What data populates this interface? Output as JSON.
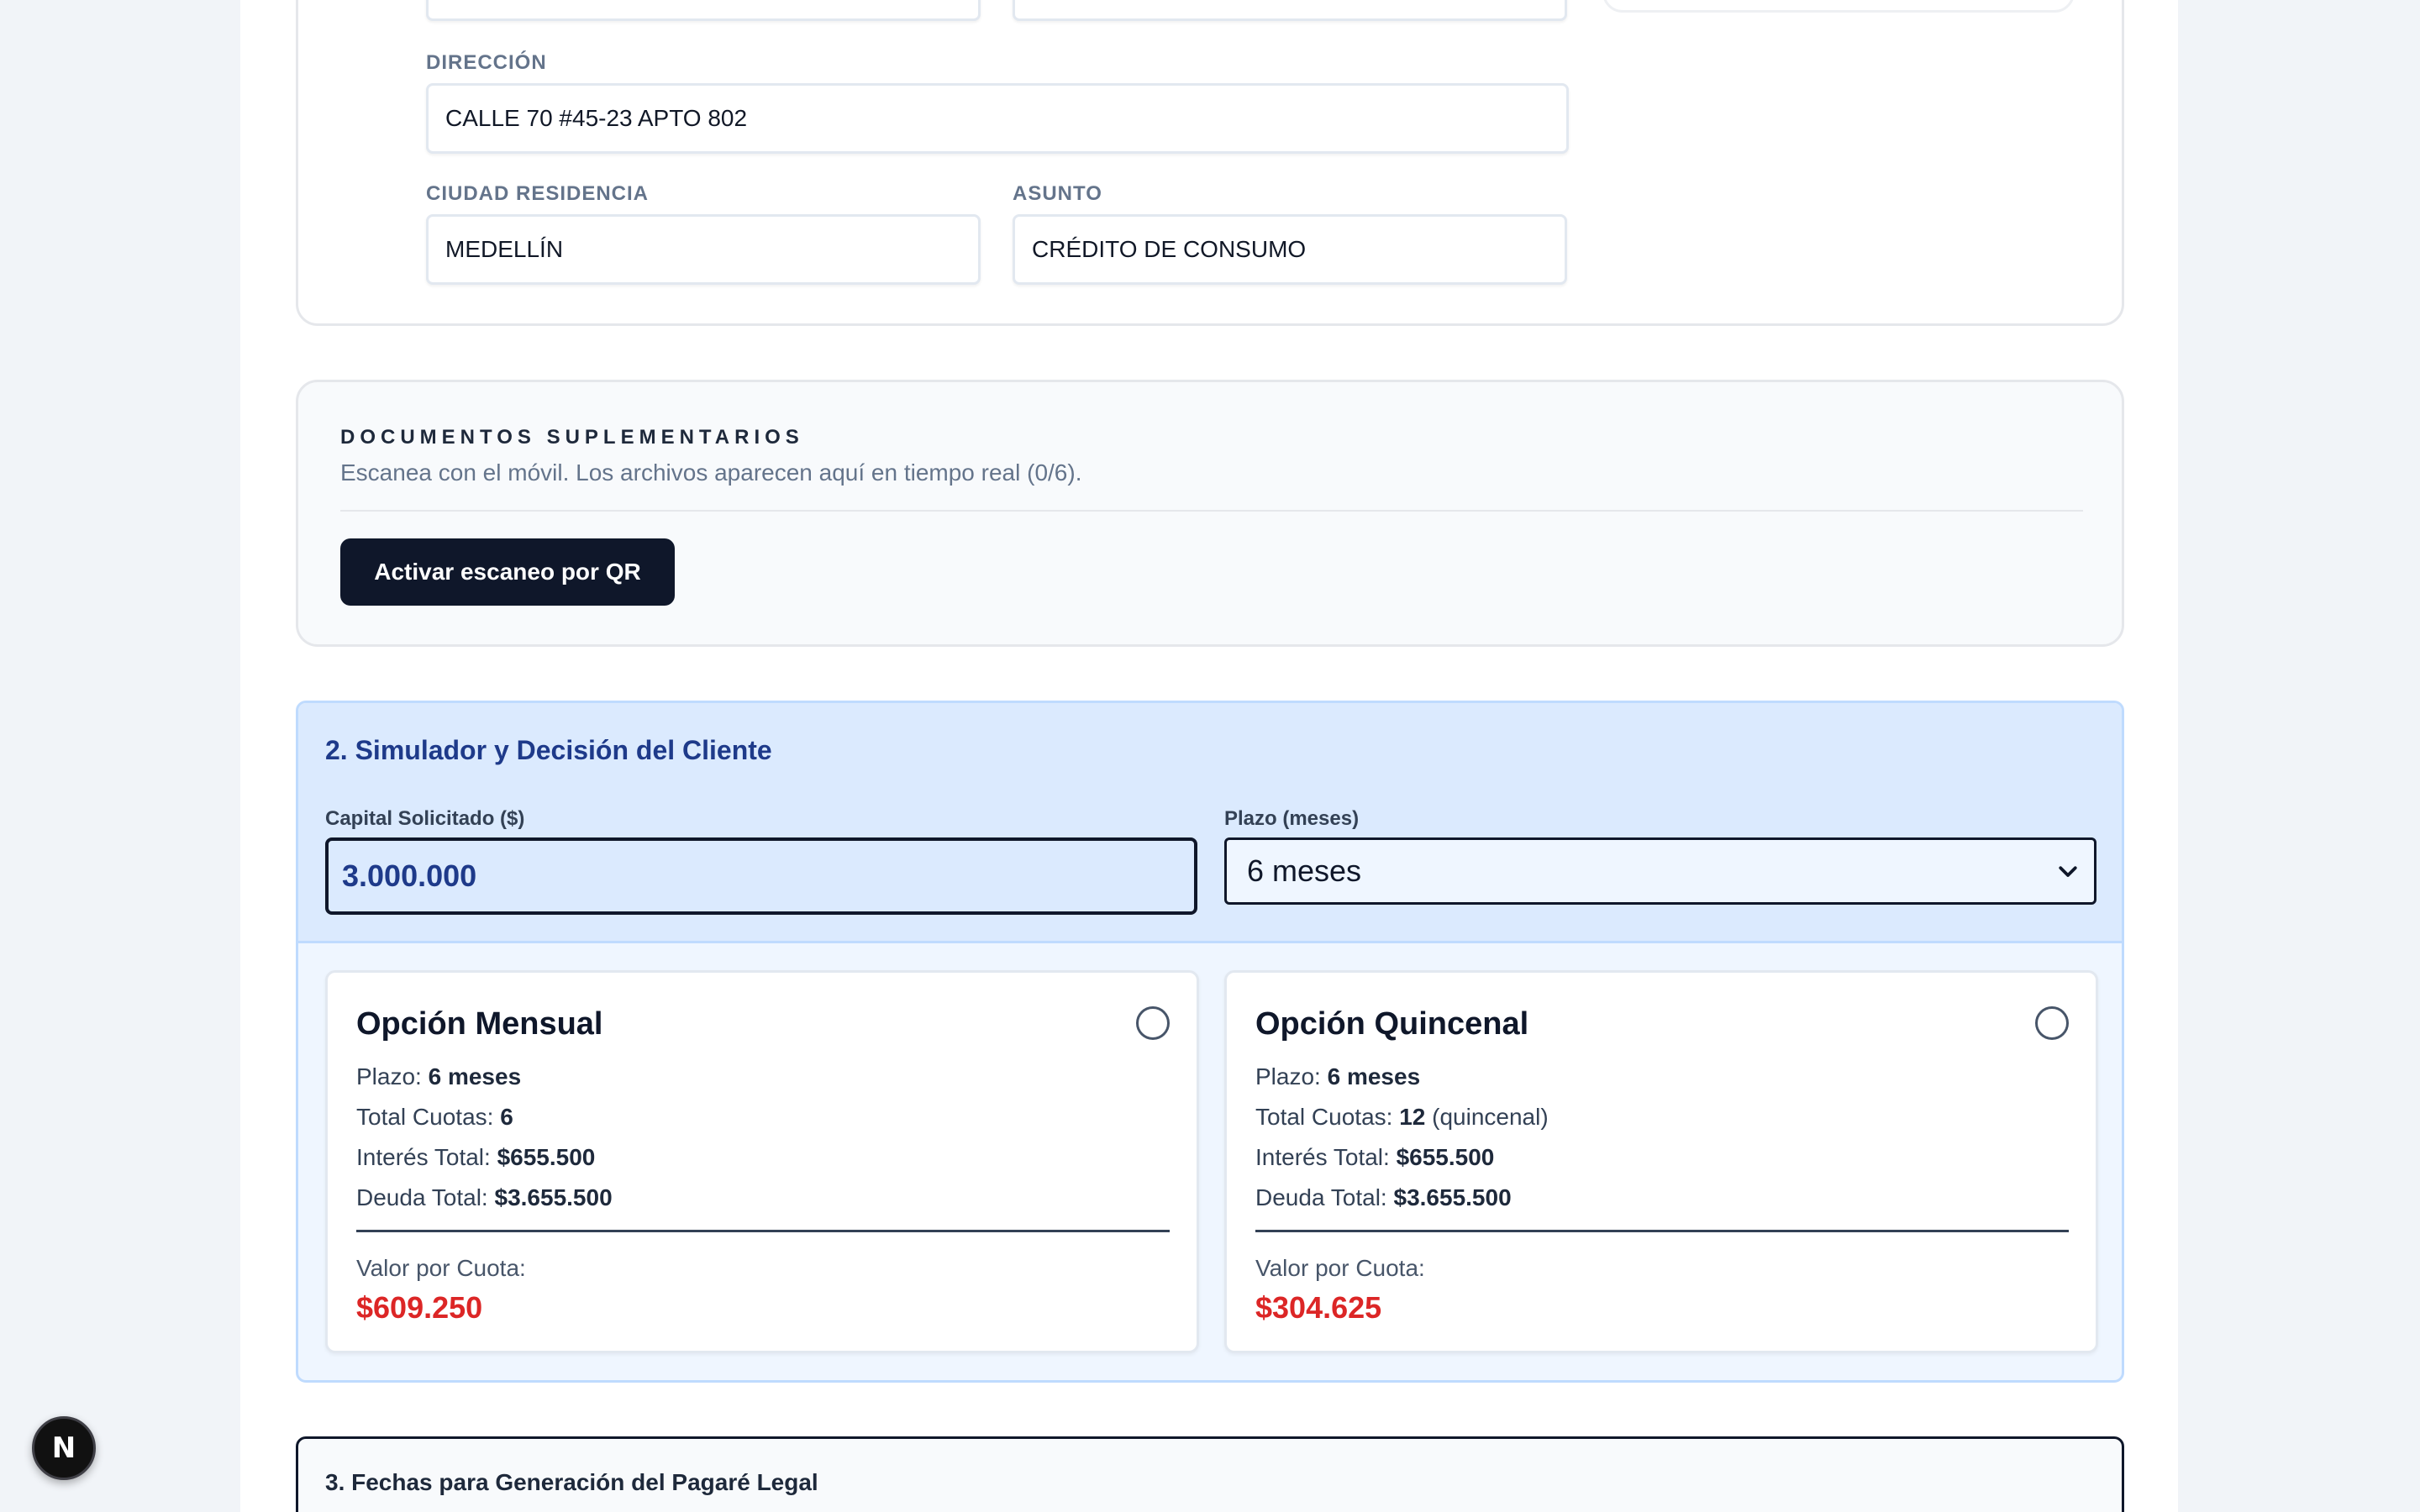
{
  "personal": {
    "direccion_label": "DIRECCIÓN",
    "direccion_value": "CALLE 70 #45-23 APTO 802",
    "ciudad_label": "CIUDAD RESIDENCIA",
    "ciudad_value": "MEDELLÍN",
    "asunto_label": "ASUNTO",
    "asunto_value": "CRÉDITO DE CONSUMO"
  },
  "documentos": {
    "title": "DOCUMENTOS SUPLEMENTARIOS",
    "subtitle": "Escanea con el móvil. Los archivos aparecen aquí en tiempo real (0/6).",
    "qr_button": "Activar escaneo por QR"
  },
  "simulador": {
    "title": "2. Simulador y Decisión del Cliente",
    "capital_label": "Capital Solicitado ($)",
    "capital_value": "3.000.000",
    "plazo_label": "Plazo (meses)",
    "plazo_selected": "6 meses",
    "mensual": {
      "title": "Opción Mensual",
      "plazo_label": "Plazo: ",
      "plazo_value": "6 meses",
      "cuotas_label": "Total Cuotas: ",
      "cuotas_value": "6",
      "cuotas_suffix": "",
      "interes_label": "Interés Total: ",
      "interes_value": "$655.500",
      "deuda_label": "Deuda Total: ",
      "deuda_value": "$3.655.500",
      "vpc_label": "Valor por Cuota:",
      "vpc_value": "$609.250"
    },
    "quincenal": {
      "title": "Opción Quincenal",
      "plazo_label": "Plazo: ",
      "plazo_value": "6 meses",
      "cuotas_label": "Total Cuotas: ",
      "cuotas_value": "12",
      "cuotas_suffix": " (quincenal)",
      "interes_label": "Interés Total: ",
      "interes_value": "$655.500",
      "deuda_label": "Deuda Total: ",
      "deuda_value": "$3.655.500",
      "vpc_label": "Valor por Cuota:",
      "vpc_value": "$304.625"
    }
  },
  "fechas": {
    "title": "3. Fechas para Generación del Pagaré Legal"
  },
  "next_badge": "N",
  "colors": {
    "accent_dark": "#0f172a",
    "sim_blue": "#dbeafe",
    "title_blue": "#1e3a8a",
    "price_red": "#dc2626"
  }
}
